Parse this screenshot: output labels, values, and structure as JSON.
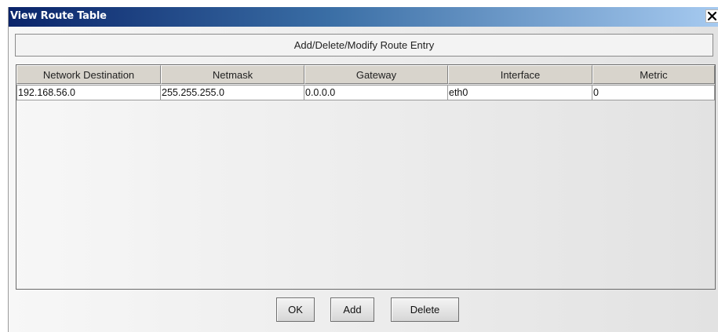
{
  "window": {
    "title": "View Route Table",
    "close_glyph": "✕"
  },
  "header": {
    "label": "Add/Delete/Modify Route Entry"
  },
  "table": {
    "columns": [
      "Network Destination",
      "Netmask",
      "Gateway",
      "Interface",
      "Metric"
    ],
    "rows": [
      [
        "192.168.56.0",
        "255.255.255.0",
        "0.0.0.0",
        "eth0",
        "0"
      ]
    ]
  },
  "buttons": {
    "ok": "OK",
    "add": "Add",
    "delete": "Delete"
  },
  "colors": {
    "title_gradient_start": "#0a246a",
    "title_gradient_end": "#a6caf0",
    "header_bg": "#d8d4cc"
  }
}
